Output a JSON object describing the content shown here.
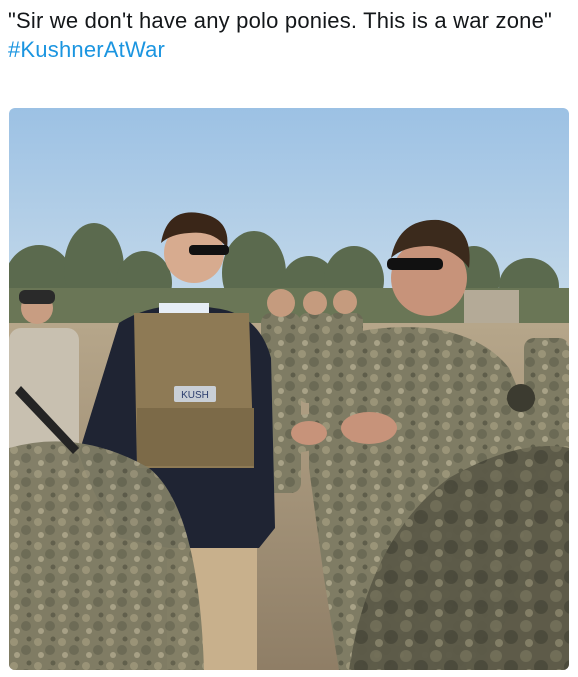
{
  "tweet": {
    "text": "\"Sir we don't have any polo ponies. This is a war zone\"",
    "hashtag": "#KushnerAtWar"
  },
  "media": {
    "vest_patch": "KUSH",
    "colors": {
      "sky": "#a9c8e6",
      "ground": "#9c8b73",
      "vest": "#8e7a55",
      "camo": "#7d7a62",
      "blazer": "#1f2433",
      "hashtag": "#1b95e0"
    }
  }
}
